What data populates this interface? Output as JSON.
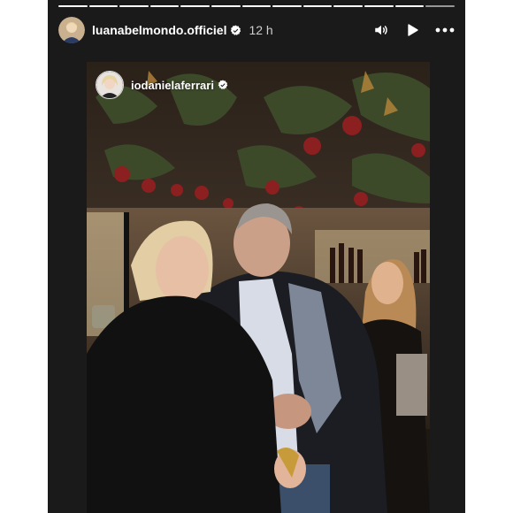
{
  "story": {
    "username": "luanabelmondo.officiel",
    "timestamp": "12 h",
    "segments_total": 13,
    "segments_completed": 12
  },
  "icons": {
    "verified": "verified-badge-icon",
    "sound": "speaker-icon",
    "play": "play-icon",
    "more": "more-icon"
  },
  "mention": {
    "username": "iodanielaferrari"
  },
  "colors": {
    "accent_white": "#ffffff",
    "story_bg": "#1a1a1a"
  }
}
